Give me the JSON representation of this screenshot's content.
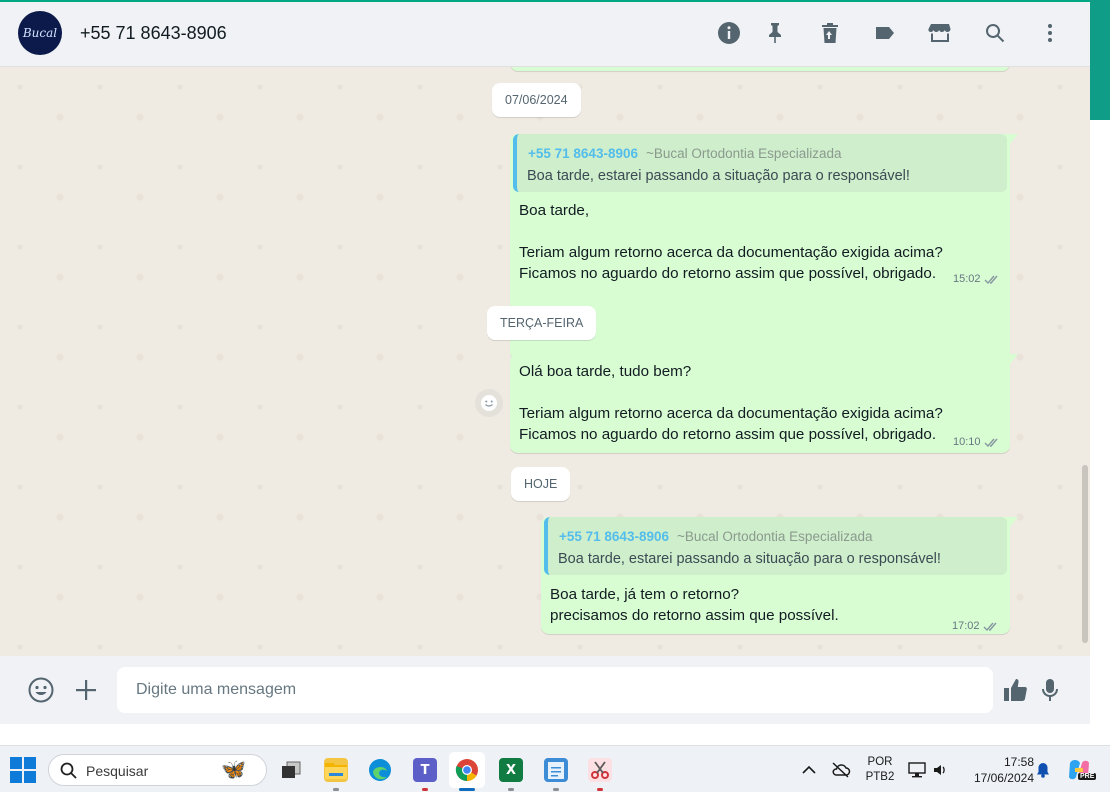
{
  "header": {
    "contact_name": "+55 71 8643-8906",
    "avatar_text": "Bucal",
    "icons": [
      "info-icon",
      "pin-icon",
      "delete-icon",
      "label-icon",
      "catalog-icon",
      "search-icon",
      "menu-icon"
    ]
  },
  "chat": {
    "date_1": "07/06/2024",
    "msg_1": {
      "quote_author": "+55 71 8643-8906",
      "quote_group": "~Bucal Ortodontia Especializada",
      "quote_text": "Boa tarde, estarei passando a situação para o responsável!",
      "line_1": "Boa tarde,",
      "line_2": "Teriam algum retorno acerca da documentação exigida acima?",
      "line_3": "Ficamos no aguardo do retorno assim que possível, obrigado.",
      "time": "15:02"
    },
    "date_2": "TERÇA-FEIRA",
    "msg_2": {
      "line_1": "Olá boa tarde, tudo bem?",
      "line_2": "Teriam algum retorno acerca da documentação exigida acima?",
      "line_3": "Ficamos no aguardo do retorno assim que possível, obrigado.",
      "time": "10:10"
    },
    "date_3": "HOJE",
    "msg_3": {
      "quote_author": "+55 71 8643-8906",
      "quote_group": "~Bucal Ortodontia Especializada",
      "quote_text": "Boa tarde, estarei passando a situação para o responsável!",
      "line_1": "Boa tarde, já tem o retorno?",
      "line_2": "precisamos do retorno assim que possível.",
      "time": "17:02"
    }
  },
  "composer": {
    "placeholder": "Digite uma mensagem"
  },
  "taskbar": {
    "search_text": "Pesquisar",
    "lang_1": "POR",
    "lang_2": "PTB2",
    "time": "17:58",
    "date": "17/06/2024",
    "copilot_badge": "PRE"
  },
  "colors": {
    "accent": "#00a884",
    "outgoing_bubble": "#d9fdd3",
    "quote_bar": "#53bdeb",
    "chat_bg": "#efeae2"
  }
}
